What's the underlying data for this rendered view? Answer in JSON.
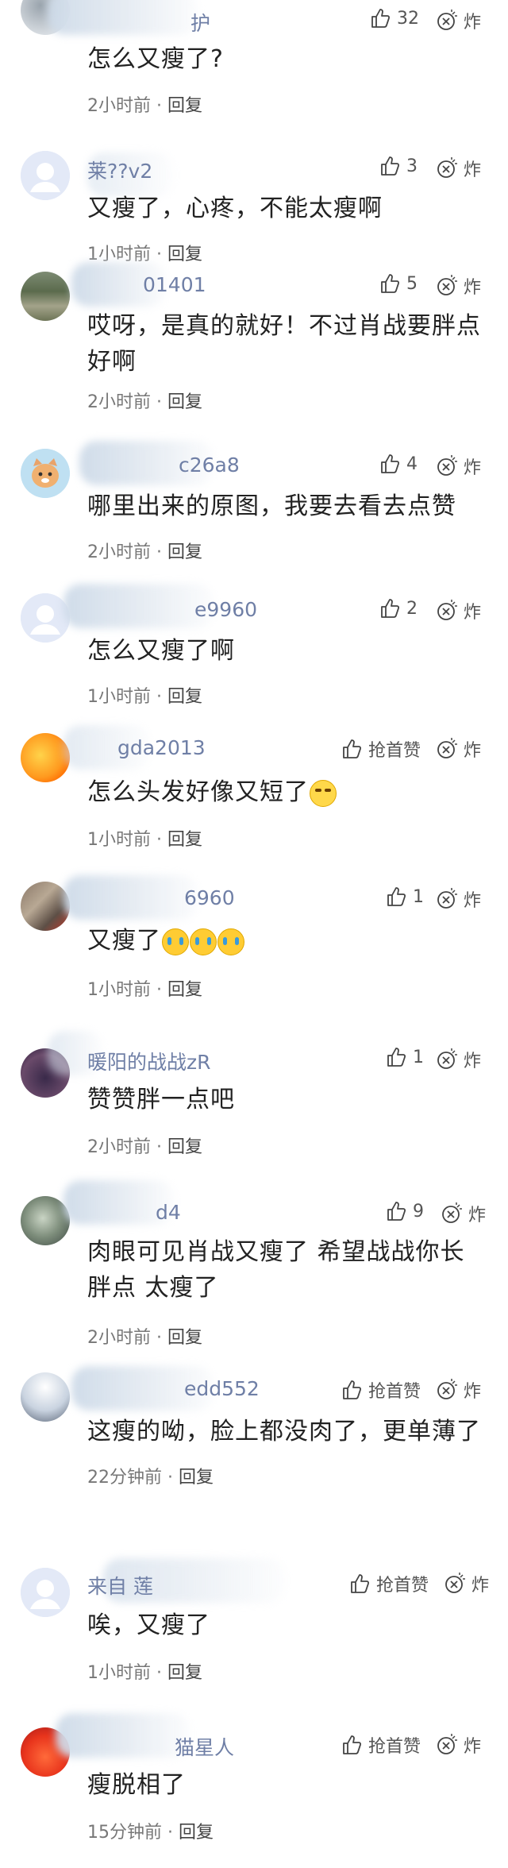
{
  "comments": [
    {
      "user": "护",
      "text": "怎么又瘦了?",
      "time": "2小时前",
      "reply": "回复",
      "likes": "32",
      "zha": "炸"
    },
    {
      "user": "莱??v2",
      "text": "又瘦了，心疼，不能太瘦啊",
      "time": "1小时前",
      "reply": "回复",
      "likes": "3",
      "zha": "炸"
    },
    {
      "user": "01401",
      "text": "哎呀，是真的就好！不过肖战要胖点好啊",
      "time": "2小时前",
      "reply": "回复",
      "likes": "5",
      "zha": "炸"
    },
    {
      "user": "c26a8",
      "text": "哪里出来的原图，我要去看去点赞",
      "time": "2小时前",
      "reply": "回复",
      "likes": "4",
      "zha": "炸"
    },
    {
      "user": "e9960",
      "text": "怎么又瘦了啊",
      "time": "1小时前",
      "reply": "回复",
      "likes": "2",
      "zha": "炸"
    },
    {
      "user": "gda2013",
      "text": "怎么头发好像又短了",
      "time": "1小时前",
      "reply": "回复",
      "likes": "抢首赞",
      "zha": "炸"
    },
    {
      "user": "6960",
      "text": "又瘦了",
      "time": "1小时前",
      "reply": "回复",
      "likes": "1",
      "zha": "炸"
    },
    {
      "user": "暖阳的战战zR",
      "text": "赞赞胖一点吧",
      "time": "2小时前",
      "reply": "回复",
      "likes": "1",
      "zha": "炸"
    },
    {
      "user": "d4",
      "text": "肉眼可见肖战又瘦了 希望战战你长胖点 太瘦了",
      "time": "2小时前",
      "reply": "回复",
      "likes": "9",
      "zha": "炸"
    },
    {
      "user": "edd552",
      "text": "这瘦的呦，脸上都没肉了，更单薄了",
      "time": "22分钟前",
      "reply": "回复",
      "likes": "抢首赞",
      "zha": "炸"
    },
    {
      "user": "来自 莲",
      "text": "唉，又瘦了",
      "time": "1小时前",
      "reply": "回复",
      "likes": "抢首赞",
      "zha": "炸"
    },
    {
      "user": "猫星人",
      "text": "瘦脱相了",
      "time": "15分钟前",
      "reply": "回复",
      "likes": "抢首赞",
      "zha": "炸"
    }
  ],
  "sep": " · ",
  "icons": {
    "like": "thumbs-up-icon",
    "zha": "bomb-icon"
  },
  "colors": {
    "username": "#6f7fa6",
    "text": "#222222",
    "meta": "#777777"
  }
}
